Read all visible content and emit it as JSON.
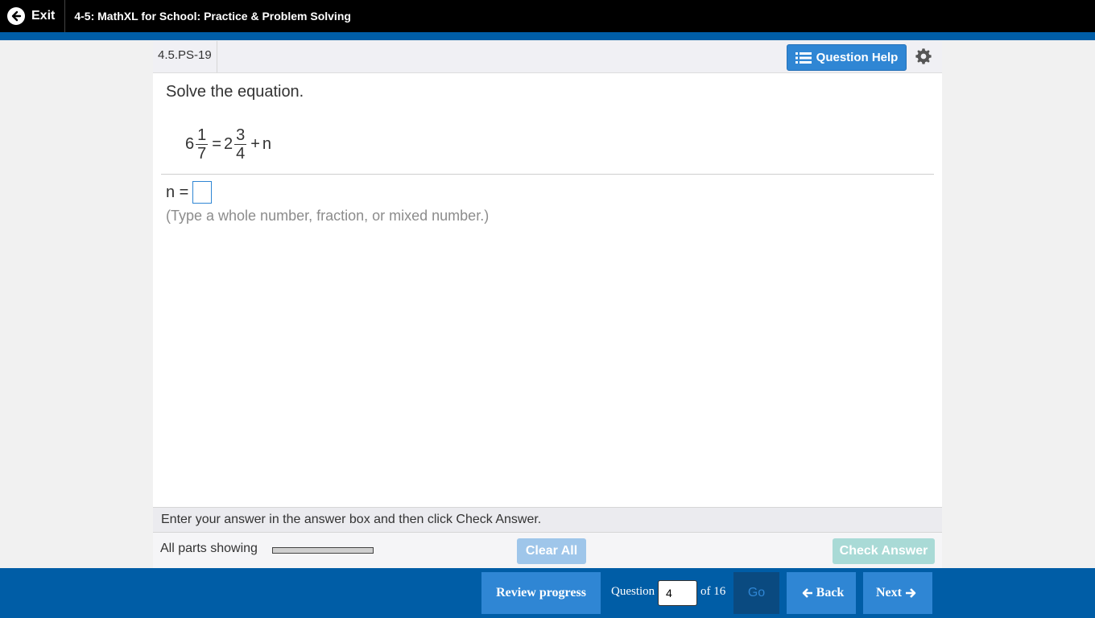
{
  "topbar": {
    "exit_label": "Exit",
    "title": "4-5: MathXL for School: Practice & Problem Solving"
  },
  "question": {
    "id": "4.5.PS-19",
    "help_label": "Question Help",
    "instruction": "Solve the equation.",
    "equation": {
      "left_whole": "6",
      "left_num": "1",
      "left_den": "7",
      "equals": "=",
      "right_whole": "2",
      "right_num": "3",
      "right_den": "4",
      "plus": "+",
      "variable": "n"
    },
    "answer_label": "n =",
    "answer_value": "",
    "hint": "(Type a whole number, fraction, or mixed number.)"
  },
  "status": {
    "message": "Enter your answer in the answer box and then click Check Answer."
  },
  "actions": {
    "parts_label": "All parts showing",
    "clear_label": "Clear All",
    "check_label": "Check Answer"
  },
  "nav": {
    "review_label": "Review progress",
    "question_label": "Question",
    "question_number": "4",
    "of_label": "of 16",
    "go_label": "Go",
    "back_label": "Back",
    "next_label": "Next"
  },
  "colors": {
    "accent": "#2f86d4",
    "nav_bar": "#005da6",
    "check_disabled": "#a9dad6",
    "clear_disabled": "#9fc6ea"
  }
}
